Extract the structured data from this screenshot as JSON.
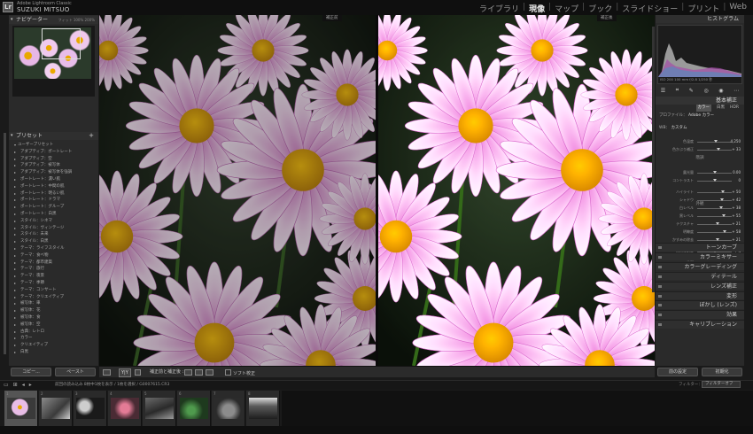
{
  "app": {
    "product": "Adobe Lightroom Classic",
    "user": "SUZUKI MITSUO"
  },
  "modules": [
    "ライブラリ",
    "現像",
    "マップ",
    "ブック",
    "スライドショー",
    "プリント",
    "Web"
  ],
  "active_module": "現像",
  "left": {
    "navigator": {
      "title": "ナビゲーター",
      "zoom": "フィット 100% 200%"
    },
    "presets": {
      "title": "プリセット",
      "items": [
        "ユーザープリセット",
        "アダプティブ：ポートレート",
        "アダプティブ：空",
        "アダプティブ：被写体",
        "アダプティブ：被写体を強調",
        "ポートレート：濃い肌",
        "ポートレート：中間の肌",
        "ポートレート：明るい肌",
        "ポートレート：ドラマ",
        "ポートレート：グループ",
        "ポートレート：白黒",
        "スタイル：シネマ",
        "スタイル：ヴィンテージ",
        "スタイル：未来",
        "スタイル：白黒",
        "テーマ：ライフスタイル",
        "テーマ：食べ物",
        "テーマ：都市建築",
        "テーマ：旅行",
        "テーマ：夜景",
        "テーマ：季節",
        "テーマ：コンサート",
        "テーマ：クリエイティブ",
        "被写体：車",
        "被写体：花",
        "被写体：食",
        "被写体：空",
        "古典：レトロ",
        "カラー",
        "クリエイティブ",
        "白黒"
      ]
    },
    "buttons": {
      "copy": "コピー...",
      "paste": "ペースト"
    }
  },
  "main": {
    "before_label": "補正前",
    "after_label": "補正後",
    "view_mode": "Y|Y",
    "compare_label": "補正前と補正後 :",
    "softproof_label": "ソフト校正"
  },
  "right": {
    "histogram": {
      "title": "ヒストグラム",
      "info": "ISO 200  100 mm  f/2.8  1/250 秒"
    },
    "basic": {
      "title": "基本補正",
      "treatment": [
        "カラー",
        "白黒",
        "HDR"
      ],
      "profile_label": "プロファイル：",
      "profile_value": "Adobe カラー",
      "wb_label": "WB：",
      "wb_value": "カスタム",
      "sliders": [
        {
          "name": "色温度",
          "value": "4,250",
          "pos": 0.55
        },
        {
          "name": "色かぶり補正",
          "value": "+ 33",
          "pos": 0.62
        },
        {
          "name": "露光量",
          "value": "0.00",
          "pos": 0.5
        },
        {
          "name": "コントラスト",
          "value": "0",
          "pos": 0.5
        },
        {
          "name": "ハイライト",
          "value": "+ 50",
          "pos": 0.75
        },
        {
          "name": "シャドウ",
          "value": "+ 42",
          "pos": 0.71
        },
        {
          "name": "白レベル",
          "value": "+ 38",
          "pos": 0.69
        },
        {
          "name": "黒レベル",
          "value": "+ 55",
          "pos": 0.78
        },
        {
          "name": "テクスチャ",
          "value": "+ 21",
          "pos": 0.6
        },
        {
          "name": "明瞭度",
          "value": "+ 58",
          "pos": 0.79
        },
        {
          "name": "かすみの除去",
          "value": "+ 21",
          "pos": 0.6
        },
        {
          "name": "自然な彩度",
          "value": "+ 4",
          "pos": 0.52
        },
        {
          "name": "彩度",
          "value": "0",
          "pos": 0.5
        }
      ],
      "tone_label": "階調",
      "presence_label": "外観"
    },
    "sections": [
      "トーンカーブ",
      "カラーミキサー",
      "カラーグレーディング",
      "ディテール",
      "レンズ補正",
      "変形",
      "ぼかし (レンズ)",
      "効果",
      "キャリブレーション"
    ],
    "buttons": {
      "prev": "前の設定",
      "reset": "初期化"
    }
  },
  "filmstrip": {
    "info": "前回の読み込み  8枚中1枚を表示 / 1枚を選択 / G0007615.CR3",
    "filter_label": "フィルター：",
    "filter_value": "フィルターオフ",
    "thumbs": [
      "1",
      "2",
      "3",
      "4",
      "5",
      "6",
      "7",
      "8"
    ]
  }
}
